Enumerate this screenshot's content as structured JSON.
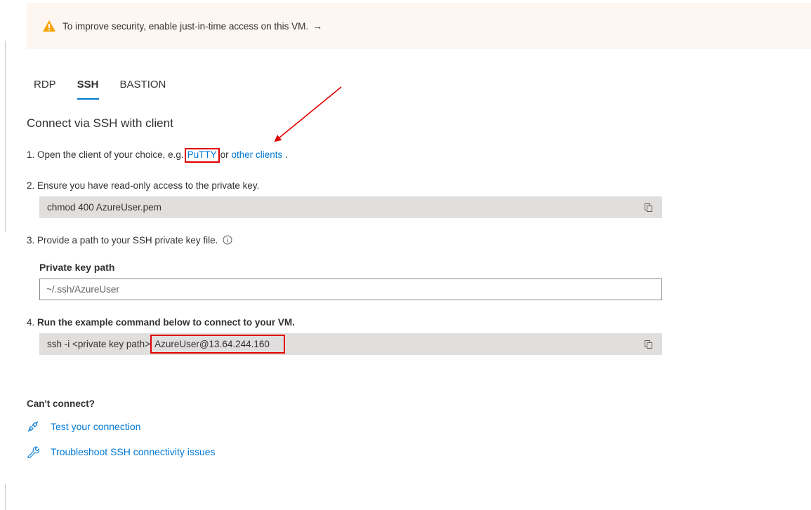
{
  "banner": {
    "text": "To improve security, enable just-in-time access on this VM.",
    "arrow": "→",
    "icon": "warning-icon"
  },
  "tabs": [
    {
      "label": "RDP",
      "active": false
    },
    {
      "label": "SSH",
      "active": true
    },
    {
      "label": "BASTION",
      "active": false
    }
  ],
  "section_title": "Connect via SSH with client",
  "step1": {
    "prefix": "1. Open the client of your choice, e.g.",
    "putty": "PuTTY",
    "middle": "or",
    "other": "other clients",
    "suffix": "."
  },
  "step2": {
    "text": "2. Ensure you have read-only access to the private key.",
    "command": "chmod 400 AzureUser.pem"
  },
  "step3": {
    "text": "3. Provide a path to your SSH private key file.",
    "field_label": "Private key path",
    "field_value": "~/.ssh/AzureUser"
  },
  "step4": {
    "prefix": "4.",
    "text": "Run the example command below to connect to your VM.",
    "command_prefix": "ssh -i <private key path>",
    "command_host": "AzureUser@13.64.244.160"
  },
  "help": {
    "heading": "Can't connect?",
    "links": [
      {
        "label": "Test your connection",
        "icon": "plug-icon"
      },
      {
        "label": "Troubleshoot SSH connectivity issues",
        "icon": "wrench-icon"
      }
    ]
  },
  "colors": {
    "accent": "#0078d4",
    "banner_bg": "#fdf6f1",
    "warning": "#f7a300",
    "annotation_red": "#e00000",
    "code_bg": "#e1dfdd"
  }
}
